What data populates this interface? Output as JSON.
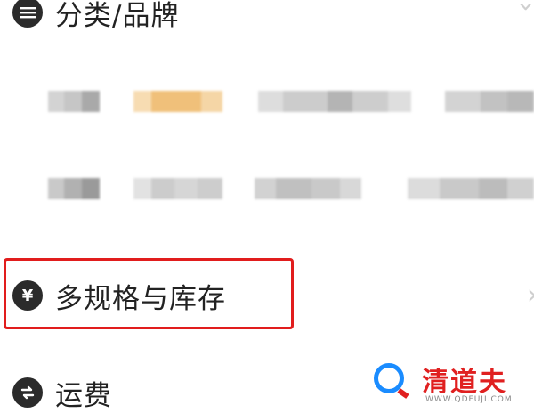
{
  "sections": {
    "category_brand": {
      "label": "分类/品牌",
      "icon": "list-icon"
    },
    "multi_spec_stock": {
      "label": "多规格与库存",
      "icon": "yen-icon",
      "icon_glyph": "¥"
    },
    "shipping": {
      "label": "运费",
      "icon": "exchange-icon"
    }
  },
  "chevrons": {
    "category": "‹",
    "spec": "›"
  },
  "watermark": {
    "title": "清道夫",
    "url": "WWW.QDFUJI.COM"
  },
  "colors": {
    "highlight": "#e11d1d",
    "selected_chip": "#f2c27a",
    "icon_bg": "#2b2b2b",
    "watermark_red": "#e02020",
    "watermark_blue": "#1a8cff"
  }
}
